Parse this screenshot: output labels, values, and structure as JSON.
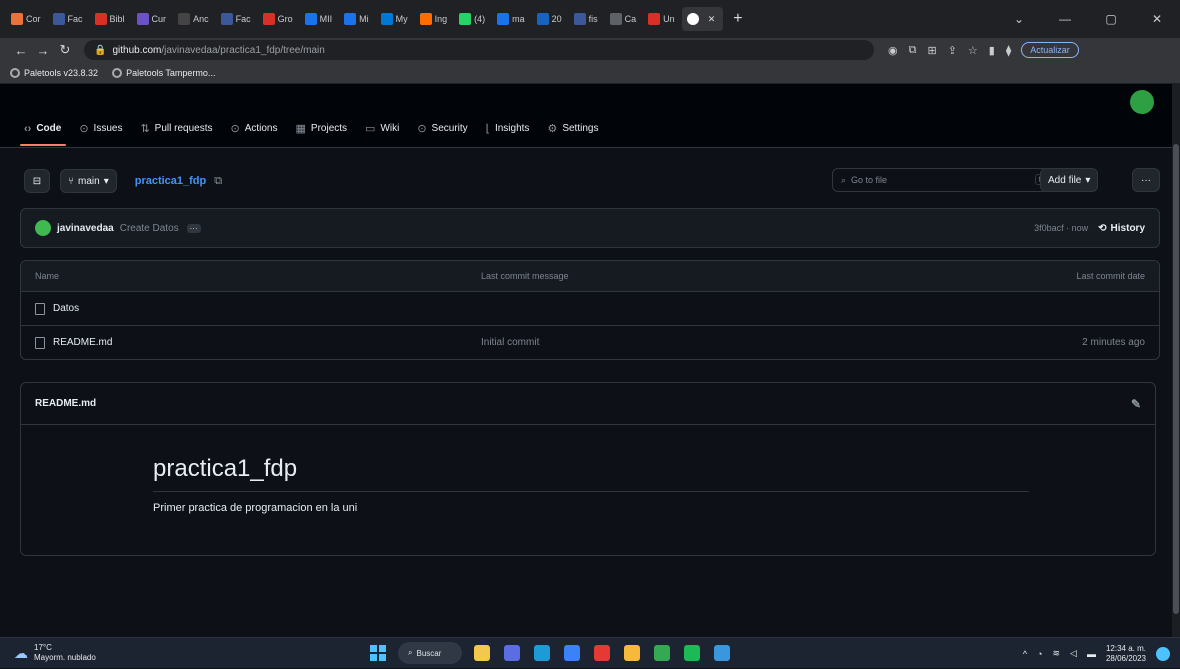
{
  "browser": {
    "tabs": [
      {
        "label": "Cor",
        "color": "#e8743b"
      },
      {
        "label": "Fac",
        "color": "#3b5998"
      },
      {
        "label": "Bibl",
        "color": "#d93025"
      },
      {
        "label": "Cur",
        "color": "#6b52c8"
      },
      {
        "label": "Anc",
        "color": "#444444"
      },
      {
        "label": "Fac",
        "color": "#3b5998"
      },
      {
        "label": "Gro",
        "color": "#d93025"
      },
      {
        "label": "MII",
        "color": "#1a73e8"
      },
      {
        "label": "Mi",
        "color": "#1a73e8"
      },
      {
        "label": "My",
        "color": "#0078d4"
      },
      {
        "label": "Ing",
        "color": "#ff6d00"
      },
      {
        "label": "(4)",
        "color": "#25d366"
      },
      {
        "label": "ma",
        "color": "#1a73e8"
      },
      {
        "label": "20",
        "color": "#1565c0"
      },
      {
        "label": "fis",
        "color": "#3b5998"
      },
      {
        "label": "Ca",
        "color": "#5f6368"
      },
      {
        "label": "Un",
        "color": "#d93025"
      }
    ],
    "active_tab_icon": "github-icon",
    "url_host": "github.com",
    "url_path": "/javinavedaa/practica1_fdp/tree/main",
    "update_label": "Actualizar",
    "bookmarks": [
      "Paletools v23.8.32",
      "Paletools Tampermo..."
    ]
  },
  "repo_nav": {
    "tabs": [
      {
        "label": "Code",
        "icon": "code-icon",
        "glyph": "‹›"
      },
      {
        "label": "Issues",
        "icon": "issues-icon",
        "glyph": "⊙"
      },
      {
        "label": "Pull requests",
        "icon": "pull-request-icon",
        "glyph": "⇅"
      },
      {
        "label": "Actions",
        "icon": "actions-icon",
        "glyph": "⊙"
      },
      {
        "label": "Projects",
        "icon": "projects-icon",
        "glyph": "▦"
      },
      {
        "label": "Wiki",
        "icon": "wiki-icon",
        "glyph": "▭"
      },
      {
        "label": "Security",
        "icon": "security-icon",
        "glyph": "⊙"
      },
      {
        "label": "Insights",
        "icon": "insights-icon",
        "glyph": "⌊"
      },
      {
        "label": "Settings",
        "icon": "settings-icon",
        "glyph": "⚙"
      }
    ]
  },
  "branch": {
    "label": "main"
  },
  "repo_name": "practica1_fdp",
  "search": {
    "placeholder": "Go to file",
    "kbd": "t"
  },
  "add_file_label": "Add file",
  "more_label": "···",
  "commit": {
    "user": "javinavedaa",
    "message": "Create Datos",
    "dots": "···",
    "hash_time": "3f0bacf · now",
    "history_label": "History"
  },
  "files": {
    "headers": {
      "name": "Name",
      "message": "Last commit message",
      "date": "Last commit date"
    },
    "rows": [
      {
        "name": "Datos",
        "message": "",
        "date": ""
      },
      {
        "name": "README.md",
        "message": "Initial commit",
        "date": "2 minutes ago"
      }
    ]
  },
  "readme": {
    "filename": "README.md",
    "title": "practica1_fdp",
    "description": "Primer practica de programacion en la uni"
  },
  "taskbar": {
    "temp": "17°C",
    "weather": "Mayorm. nublado",
    "search_label": "Buscar",
    "apps": [
      {
        "name": "file-explorer-icon",
        "color": "#f2c94c"
      },
      {
        "name": "meet-icon",
        "color": "#5b6ee1"
      },
      {
        "name": "edge-icon",
        "color": "#1e9bd7"
      },
      {
        "name": "store-icon",
        "color": "#3b82f6"
      },
      {
        "name": "opera-icon",
        "color": "#e53935"
      },
      {
        "name": "files-icon",
        "color": "#f6b93b"
      },
      {
        "name": "chrome-icon",
        "color": "#34a853"
      },
      {
        "name": "spotify-icon",
        "color": "#1db954"
      },
      {
        "name": "vscode-icon",
        "color": "#3a96dd"
      }
    ],
    "time": "12:34 a. m.",
    "date": "28/06/2023"
  }
}
